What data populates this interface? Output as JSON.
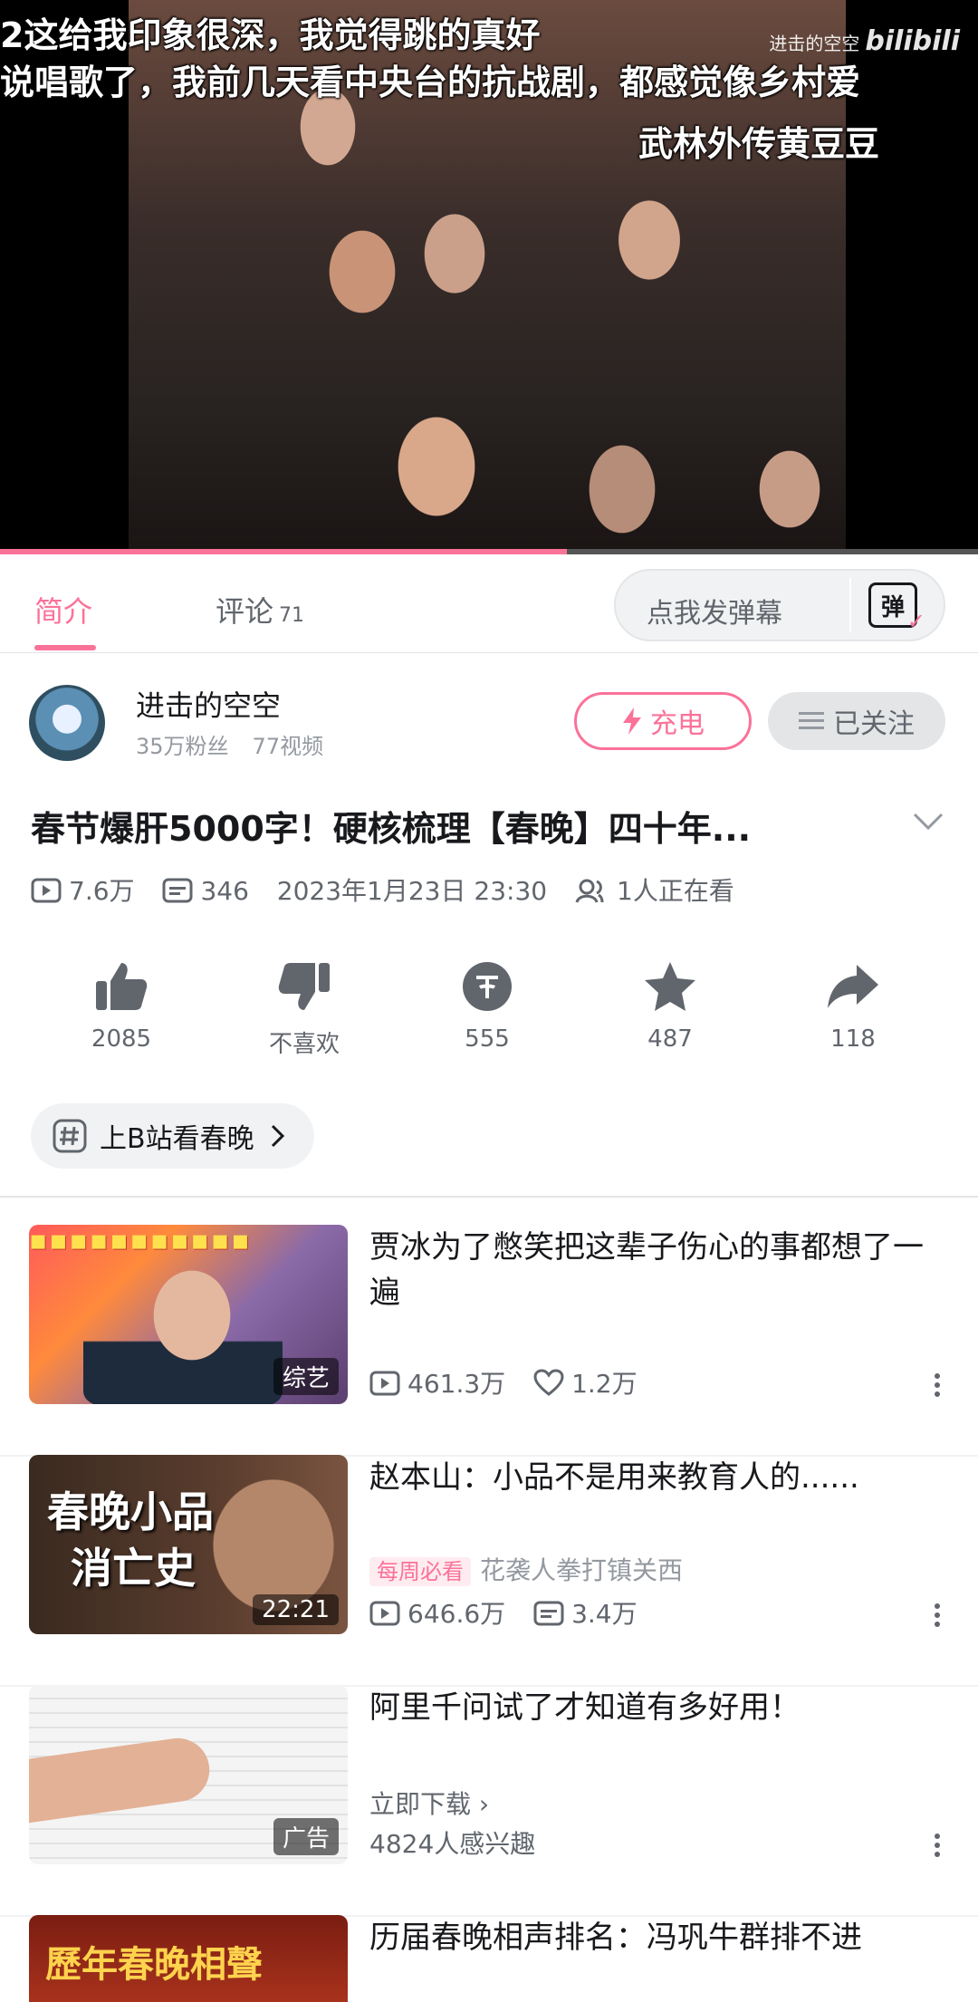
{
  "video": {
    "danmaku": [
      "2这给我印象很深，我觉得跳的真好",
      "说唱歌了，我前几天看中央台的抗战剧，都感觉像乡村爱",
      "武林外传黄豆豆"
    ],
    "watermark_user": "进击的空空",
    "watermark_brand": "bilibili",
    "progress": 0.58
  },
  "tabs": [
    {
      "label": "简介",
      "active": true
    },
    {
      "label": "评论",
      "count": "71",
      "active": false
    }
  ],
  "danmaku_input": {
    "placeholder": "点我发弹幕",
    "button": "弹"
  },
  "uploader": {
    "name": "进击的空空",
    "fans": "35万粉丝",
    "videos": "77视频",
    "charge_label": "充电",
    "follow_label": "已关注"
  },
  "video_info": {
    "title": "春节爆肝5000字！硬核梳理【春晚】四十年...",
    "plays": "7.6万",
    "danmaku_count": "346",
    "date": "2023年1月23日 23:30",
    "watching": "1人正在看"
  },
  "actions": [
    {
      "icon": "thumbs-up-icon",
      "label": "2085"
    },
    {
      "icon": "thumbs-down-icon",
      "label": "不喜欢"
    },
    {
      "icon": "coin-icon",
      "label": "555"
    },
    {
      "icon": "star-icon",
      "label": "487"
    },
    {
      "icon": "share-icon",
      "label": "118"
    }
  ],
  "tag": {
    "label": "上B站看春晚"
  },
  "feed": [
    {
      "title": "贾冰为了憋笑把这辈子伤心的事都想了一遍",
      "badge": "综艺",
      "plays": "461.3万",
      "likes": "1.2万"
    },
    {
      "title": "赵本山：小品不是用来教育人的......",
      "badge": "22:21",
      "weekly": "每周必看",
      "owner": "花袭人拳打镇关西",
      "plays": "646.6万",
      "danmaku": "3.4万",
      "thumb_text": [
        "春晚小品",
        "消亡史"
      ]
    },
    {
      "title": "阿里千问试了才知道有多好用！",
      "badge": "广告",
      "cta": "立即下载",
      "interest": "4824人感兴趣"
    },
    {
      "title": "历届春晚相声排名：冯巩牛群排不进",
      "thumb_text": "歷年春晚相聲"
    }
  ],
  "colors": {
    "accent": "#fb7299",
    "text": "#18191c",
    "secondary": "#61666d",
    "muted": "#9499a0"
  }
}
